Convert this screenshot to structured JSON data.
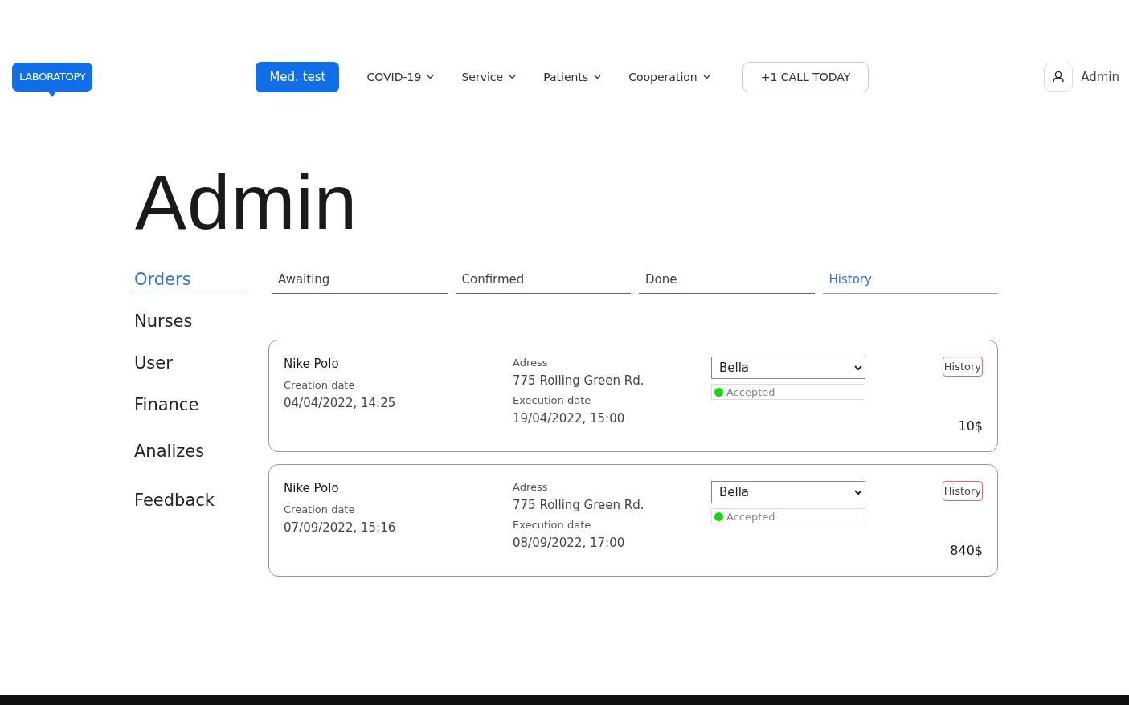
{
  "logo": "LABORATOPY",
  "nav": [
    {
      "label": "Med. test",
      "kind": "primary"
    },
    {
      "label": "COVID-19",
      "kind": "dropdown"
    },
    {
      "label": "Service",
      "kind": "dropdown"
    },
    {
      "label": "Patients",
      "kind": "dropdown"
    },
    {
      "label": "Cooperation",
      "kind": "dropdown"
    }
  ],
  "call_button": "+1 CALL TODAY",
  "user": {
    "name": "Admin"
  },
  "page_title": "Admin",
  "sidebar": {
    "items": [
      {
        "label": "Orders",
        "selected": true
      },
      {
        "label": "Nurses",
        "selected": false
      },
      {
        "label": "User",
        "selected": false
      },
      {
        "label": "Finance",
        "selected": false
      },
      {
        "label": "Analizes",
        "selected": false
      },
      {
        "label": "Feedback",
        "selected": false
      }
    ]
  },
  "tabs": [
    {
      "label": "Awaiting",
      "selected": false
    },
    {
      "label": "Confirmed",
      "selected": false
    },
    {
      "label": "Done",
      "selected": false
    },
    {
      "label": "History",
      "selected": true
    }
  ],
  "orders": [
    {
      "patient": "Nike Polo",
      "creation_label": "Creation date",
      "creation_date": "04/04/2022, 14:25",
      "address_label": "Adress",
      "address": "775 Rolling Green Rd.",
      "execution_label": "Execution date",
      "execution_date": "19/04/2022, 15:00",
      "nurse": "Bella",
      "status": {
        "label": "Accepted",
        "color": "#12d812"
      },
      "history_button": "History",
      "price": "10$"
    },
    {
      "patient": "Nike Polo",
      "creation_label": "Creation date",
      "creation_date": "07/09/2022, 15:16",
      "address_label": "Adress",
      "address": "775 Rolling Green Rd.",
      "execution_label": "Execution date",
      "execution_date": "08/09/2022, 17:00",
      "nurse": "Bella",
      "status": {
        "label": "Accepted",
        "color": "#12d812"
      },
      "history_button": "History",
      "price": "840$"
    }
  ]
}
